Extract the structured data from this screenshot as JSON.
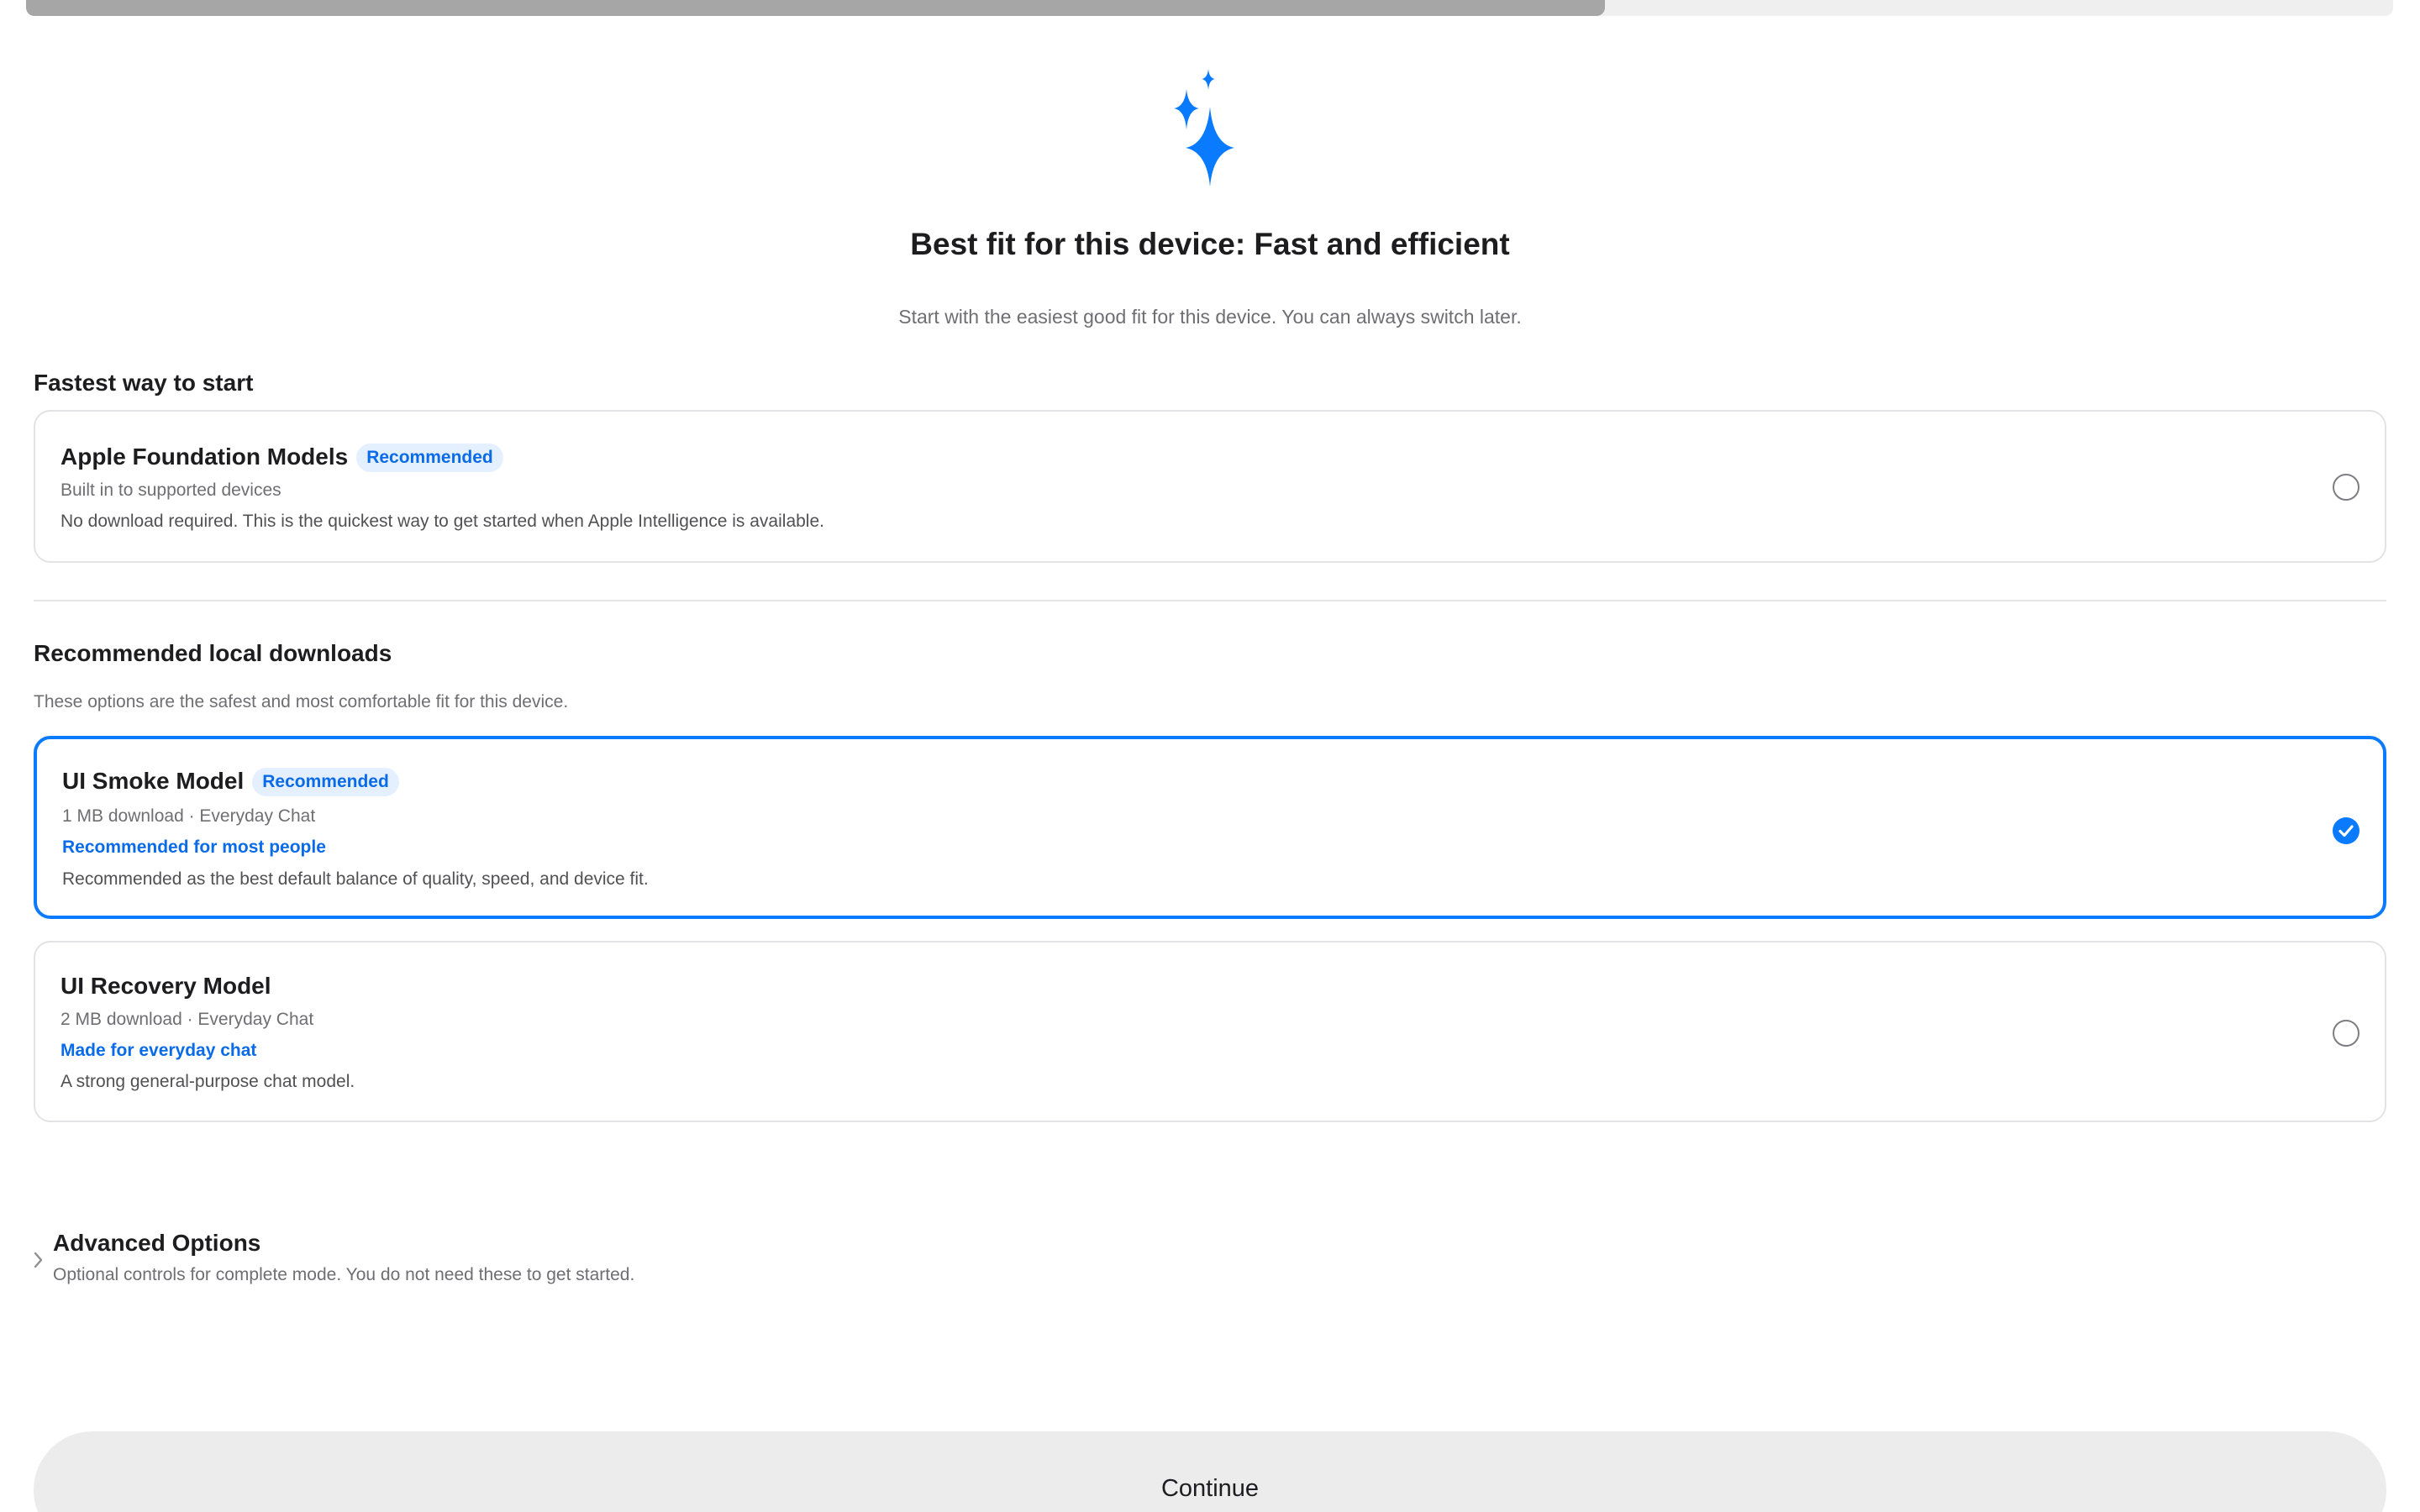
{
  "progress": {
    "fraction": 0.667
  },
  "hero": {
    "icon": "sparkles-icon",
    "accent_color": "#0a7aff"
  },
  "header": {
    "title": "Best fit for this device: Fast and efficient",
    "subtitle": "Start with the easiest good fit for this device. You can always switch later."
  },
  "fastest": {
    "section_title": "Fastest way to start",
    "card": {
      "name": "Apple Foundation Models",
      "badge": "Recommended",
      "meta": "Built in to supported devices",
      "description": "No download required. This is the quickest way to get started when Apple Intelligence is available.",
      "selected": false
    }
  },
  "downloads": {
    "section_title": "Recommended local downloads",
    "section_desc": "These options are the safest and most comfortable fit for this device.",
    "cards": [
      {
        "name": "UI Smoke Model",
        "badge": "Recommended",
        "meta": "1 MB download · Everyday Chat",
        "tag": "Recommended for most people",
        "description": "Recommended as the best default balance of quality, speed, and device fit.",
        "selected": true
      },
      {
        "name": "UI Recovery Model",
        "meta": "2 MB download · Everyday Chat",
        "tag": "Made for everyday chat",
        "description": "A strong general-purpose chat model.",
        "selected": false
      }
    ]
  },
  "advanced": {
    "title": "Advanced Options",
    "description": "Optional controls for complete mode. You do not need these to get started.",
    "icon": "chevron-right-icon"
  },
  "footer": {
    "continue_label": "Continue"
  },
  "colors": {
    "accent": "#0a7aff",
    "badge_bg": "#e4efff",
    "button_bg": "#ececec"
  }
}
